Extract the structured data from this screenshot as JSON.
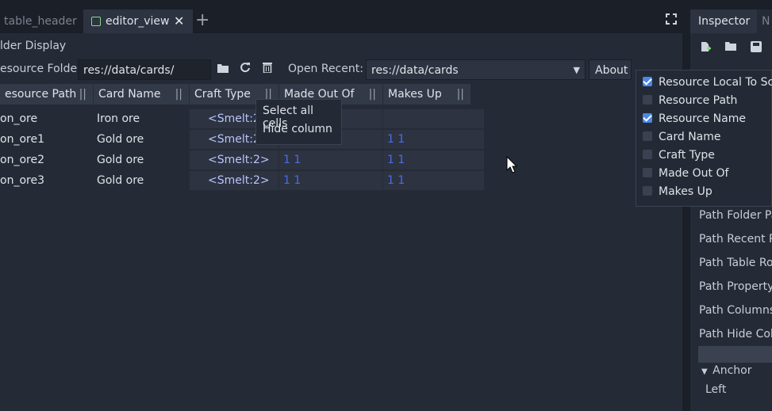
{
  "tabs": [
    {
      "label": "table_header",
      "active": false
    },
    {
      "label": "editor_view",
      "active": true
    }
  ],
  "add_tab": "+",
  "inspector": {
    "tab_label": "Inspector",
    "tab2_label": "N",
    "rows": [
      "Path Folder Pa",
      "Path Recent P",
      "Path Table Ro",
      "Path Property",
      "Path Columns",
      "Path Hide Colu"
    ],
    "anchor_label": "Anchor",
    "anchor_value": "Left"
  },
  "section_title": "lder Display",
  "resource_folder": {
    "label": "esource Folder:",
    "value": "res://data/cards/"
  },
  "open_recent": {
    "label": "Open Recent:",
    "value": "res://data/cards"
  },
  "about_label": "About",
  "columns": [
    "esource Path",
    "Card Name",
    "Craft Type",
    "Made Out Of",
    "Makes Up"
  ],
  "column_separator": "||",
  "rows": [
    {
      "path": "on_ore",
      "name": "Iron ore",
      "craft": "<Smelt:2>",
      "made": "",
      "makes": ""
    },
    {
      "path": "on_ore1",
      "name": "Gold ore",
      "craft": "<Smelt:2>",
      "made": "",
      "makes": "1  1"
    },
    {
      "path": "on_ore2",
      "name": "Gold ore",
      "craft": "<Smelt:2>",
      "made": "1  1",
      "makes": "1  1"
    },
    {
      "path": "on_ore3",
      "name": "Gold ore",
      "craft": "<Smelt:2>",
      "made": "1  1",
      "makes": "1  1"
    }
  ],
  "context_menu": [
    "Select all cells",
    "Hide column"
  ],
  "column_popup": [
    {
      "label": "Resource Local To Sce",
      "checked": true
    },
    {
      "label": "Resource Path",
      "checked": false
    },
    {
      "label": "Resource Name",
      "checked": true
    },
    {
      "label": "Card Name",
      "checked": false
    },
    {
      "label": "Craft Type",
      "checked": false
    },
    {
      "label": "Made Out Of",
      "checked": false
    },
    {
      "label": "Makes Up",
      "checked": false
    }
  ],
  "colors": {
    "accent": "#4a88e8",
    "link_blue": "#4a6ce8",
    "bg": "#202531"
  }
}
